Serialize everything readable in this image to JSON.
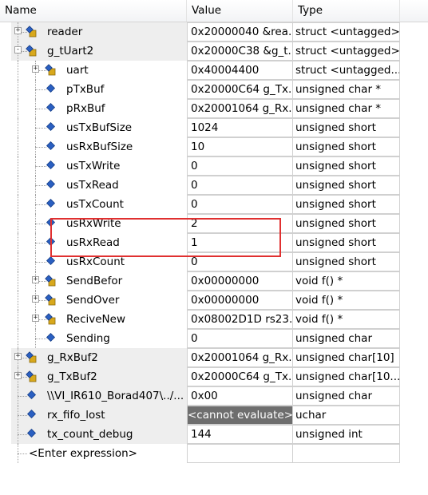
{
  "columns": {
    "name": "Name",
    "value": "Value",
    "type": "Type"
  },
  "rows": [
    {
      "label": "reader",
      "value": "0x20000040 &rea...",
      "type": "struct <untagged>",
      "icon": "struct-icon",
      "exp": "+",
      "depth": 0,
      "shaded": true
    },
    {
      "label": "g_tUart2",
      "value": "0x20000C38 &g_t...",
      "type": "struct <untagged>",
      "icon": "struct-icon",
      "exp": "-",
      "depth": 0,
      "shaded": true
    },
    {
      "label": "uart",
      "value": "0x40004400",
      "type": "struct <untagged...",
      "icon": "struct-icon",
      "exp": "+",
      "depth": 1,
      "shaded": false
    },
    {
      "label": "pTxBuf",
      "value": "0x20000C64 g_Tx...",
      "type": "unsigned char *",
      "icon": "variable-icon",
      "exp": "",
      "depth": 1,
      "shaded": false
    },
    {
      "label": "pRxBuf",
      "value": "0x20001064 g_Rx...",
      "type": "unsigned char *",
      "icon": "variable-icon",
      "exp": "",
      "depth": 1,
      "shaded": false
    },
    {
      "label": "usTxBufSize",
      "value": "1024",
      "type": "unsigned short",
      "icon": "variable-icon",
      "exp": "",
      "depth": 1,
      "shaded": false
    },
    {
      "label": "usRxBufSize",
      "value": "10",
      "type": "unsigned short",
      "icon": "variable-icon",
      "exp": "",
      "depth": 1,
      "shaded": false
    },
    {
      "label": "usTxWrite",
      "value": "0",
      "type": "unsigned short",
      "icon": "variable-icon",
      "exp": "",
      "depth": 1,
      "shaded": false
    },
    {
      "label": "usTxRead",
      "value": "0",
      "type": "unsigned short",
      "icon": "variable-icon",
      "exp": "",
      "depth": 1,
      "shaded": false
    },
    {
      "label": "usTxCount",
      "value": "0",
      "type": "unsigned short",
      "icon": "variable-icon",
      "exp": "",
      "depth": 1,
      "shaded": false
    },
    {
      "label": "usRxWrite",
      "value": "2",
      "type": "unsigned short",
      "icon": "variable-icon",
      "exp": "",
      "depth": 1,
      "shaded": false
    },
    {
      "label": "usRxRead",
      "value": "1",
      "type": "unsigned short",
      "icon": "variable-icon",
      "exp": "",
      "depth": 1,
      "shaded": false
    },
    {
      "label": "usRxCount",
      "value": "0",
      "type": "unsigned short",
      "icon": "variable-icon",
      "exp": "",
      "depth": 1,
      "shaded": false
    },
    {
      "label": "SendBefor",
      "value": "0x00000000",
      "type": "void f()  *",
      "icon": "struct-icon",
      "exp": "+",
      "depth": 1,
      "shaded": false
    },
    {
      "label": "SendOver",
      "value": "0x00000000",
      "type": "void f()  *",
      "icon": "struct-icon",
      "exp": "+",
      "depth": 1,
      "shaded": false
    },
    {
      "label": "ReciveNew",
      "value": "0x08002D1D rs23...",
      "type": "void f()  *",
      "icon": "struct-icon",
      "exp": "+",
      "depth": 1,
      "shaded": false
    },
    {
      "label": "Sending",
      "value": "0",
      "type": "unsigned char",
      "icon": "variable-icon",
      "exp": "",
      "depth": 1,
      "shaded": false
    },
    {
      "label": "g_RxBuf2",
      "value": "0x20001064 g_Rx...",
      "type": "unsigned char[10]",
      "icon": "struct-icon",
      "exp": "+",
      "depth": 0,
      "shaded": true
    },
    {
      "label": "g_TxBuf2",
      "value": "0x20000C64 g_Tx...",
      "type": "unsigned char[10...",
      "icon": "struct-icon",
      "exp": "+",
      "depth": 0,
      "shaded": true
    },
    {
      "label": "\\\\VI_IR610_Borad407\\../...",
      "value": "0x00",
      "type": "unsigned char",
      "icon": "variable-icon",
      "exp": "",
      "depth": 0,
      "shaded": true
    },
    {
      "label": "rx_fifo_lost",
      "value": "<cannot evaluate>",
      "type": "uchar",
      "icon": "variable-icon",
      "exp": "",
      "depth": 0,
      "shaded": true,
      "gray": true
    },
    {
      "label": "tx_count_debug",
      "value": "144",
      "type": "unsigned int",
      "icon": "variable-icon",
      "exp": "",
      "depth": 0,
      "shaded": true
    },
    {
      "label": "<Enter expression>",
      "value": "",
      "type": "",
      "icon": "",
      "exp": "",
      "depth": 0,
      "shaded": false,
      "enter": true
    }
  ],
  "colors": {
    "shade": "#eeeeee",
    "highlight": "#e03030",
    "gray_cell": "#6e6e6e",
    "icon_blue": "#2a5fc1",
    "icon_yellow": "#d8a81c"
  }
}
